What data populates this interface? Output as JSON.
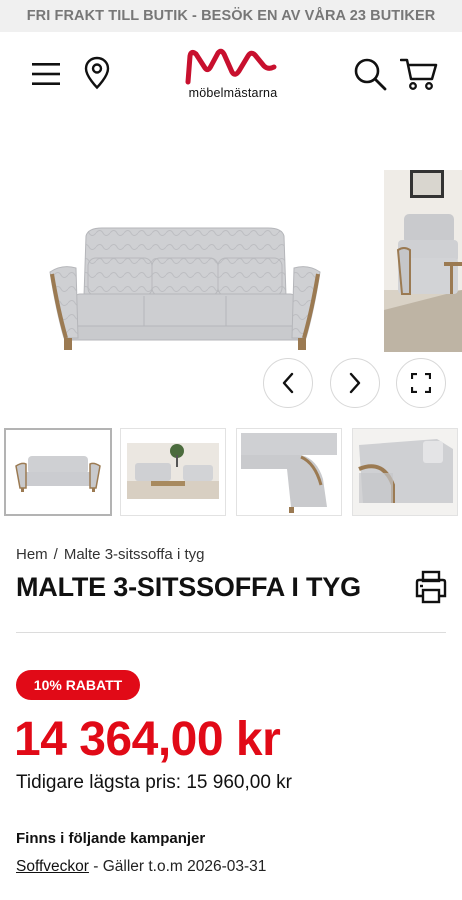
{
  "topbar": {
    "text": "FRI FRAKT TILL BUTIK - BESÖK EN AV VÅRA 23 BUTIKER"
  },
  "header": {
    "logo_text": "möbelmästarna",
    "icons": [
      "menu-icon",
      "location-pin-icon",
      "search-icon",
      "cart-icon"
    ],
    "brand_color": "#c8102e"
  },
  "gallery": {
    "nav": [
      "chevron-left-icon",
      "chevron-right-icon",
      "fullscreen-icon"
    ],
    "thumbnails": 4,
    "active_thumbnail": 1
  },
  "breadcrumb": {
    "home": "Hem",
    "separator": "/",
    "current": "Malte 3-sitssoffa i tyg"
  },
  "product": {
    "title": "MALTE 3-SITSSOFFA I TYG",
    "badge": "10% RABATT",
    "price": "14 364,00 kr",
    "previous_price": "Tidigare lägsta pris: 15 960,00 kr",
    "accent_color": "#e10a17"
  },
  "campaigns": {
    "heading": "Finns i följande kampanjer",
    "items": [
      {
        "name": "Soffveckor",
        "validity": " - Gäller t.o.m 2026-03-31"
      }
    ]
  }
}
